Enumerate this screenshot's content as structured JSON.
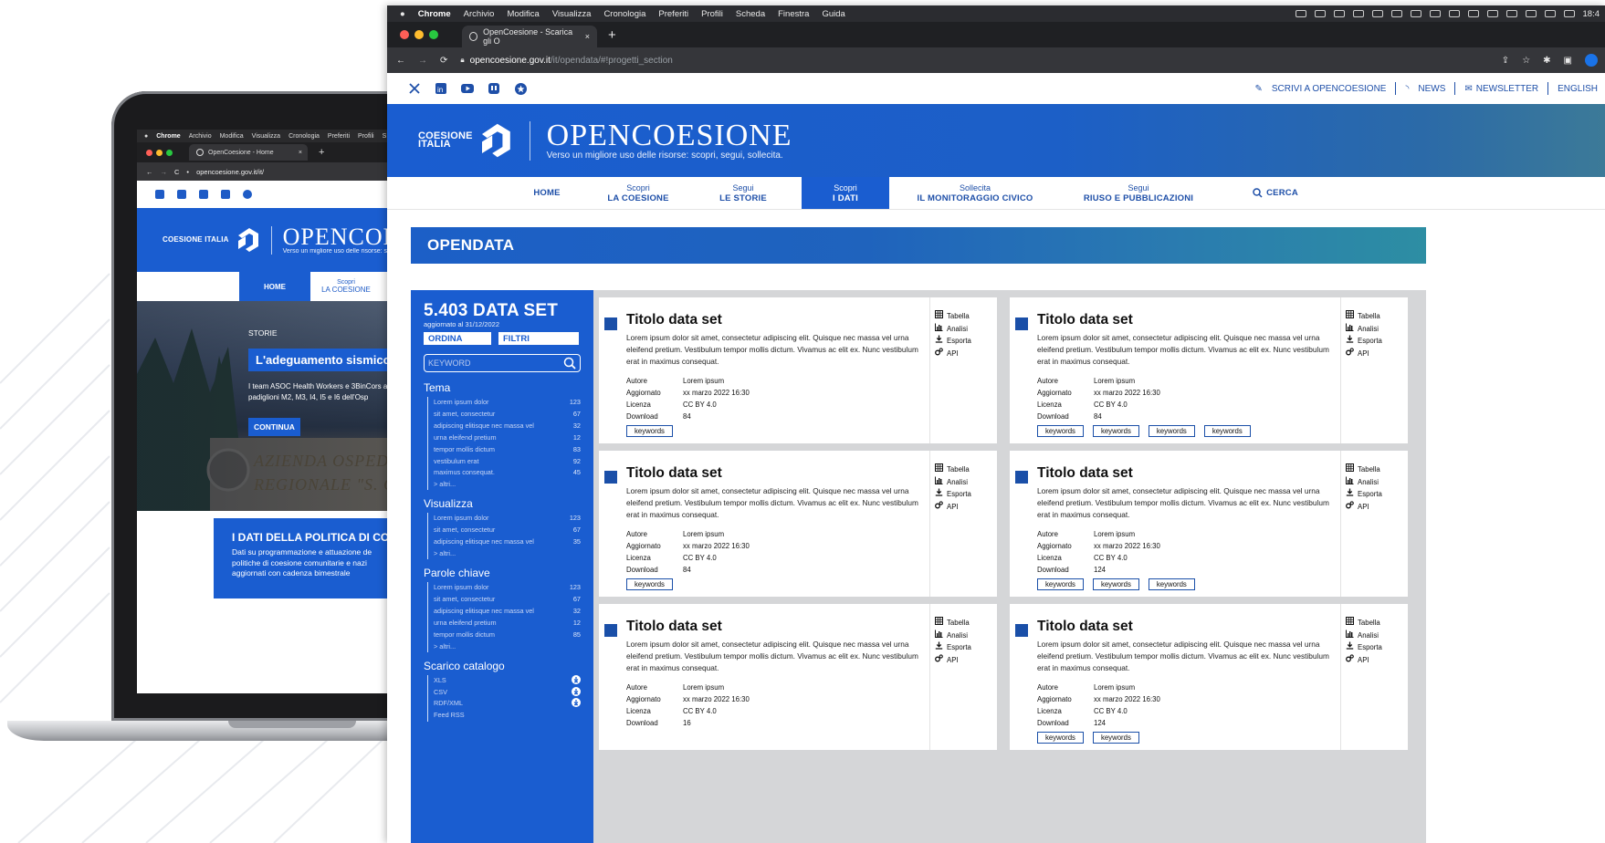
{
  "colors": {
    "brand_blue": "#1a5dd0",
    "dark_blue": "#1a4fa8",
    "nav_blue": "#1e4fa8"
  },
  "laptop": {
    "menubar": [
      "Chrome",
      "Archivio",
      "Modifica",
      "Visualizza",
      "Cronologia",
      "Preferiti",
      "Profili",
      "S"
    ],
    "tab_title": "OpenCoesione - Home",
    "url": "opencoesione.gov.it/it/",
    "logo": "COESIONE ITALIA",
    "brand": "OPENCOESI",
    "tagline": "Verso un migliore uso delle risorse: scop",
    "nav": [
      {
        "l1": "",
        "l2": "HOME"
      },
      {
        "l1": "Scopri",
        "l2": "LA COESIONE"
      }
    ],
    "story_label": "STORIE",
    "story_title": "L'adeguamento sismico de",
    "story_text": "I team ASOC Health Workers e 3BinCors ai padiglioni M2, M3, I4, I5 e I6 dell'Osp",
    "continue": "CONTINUA",
    "sign_line1": "AZIENDA OSPEDA",
    "sign_line2": "REGIONALE \"S. C",
    "card_title": "I DATI DELLA POLITICA DI COE",
    "card_text": "Dati su programmazione e attuazione de politiche di coesione comunitarie e nazi aggiornati con cadenza bimestrale"
  },
  "browser": {
    "menubar": [
      "Chrome",
      "Archivio",
      "Modifica",
      "Visualizza",
      "Cronologia",
      "Preferiti",
      "Profili",
      "Scheda",
      "Finestra",
      "Guida"
    ],
    "clock": "18:4",
    "tab_title": "OpenCoesione - Scarica gli O",
    "url_host": "opencoesione.gov.it",
    "url_path": "/it/opendata/#!progetti_section",
    "toplinks": [
      "SCRIVI A OPENCOESIONE",
      "NEWS",
      "NEWSLETTER",
      "ENGLISH"
    ],
    "logo_line1": "COESIONE",
    "logo_line2": "ITALIA",
    "brand": "OPENCOESIONE",
    "tagline": "Verso un migliore uso delle risorse: scopri, segui, sollecita.",
    "nav": [
      {
        "l1": "",
        "l2": "HOME"
      },
      {
        "l1": "Scopri",
        "l2": "LA COESIONE"
      },
      {
        "l1": "Segui",
        "l2": "LE STORIE"
      },
      {
        "l1": "Scopri",
        "l2": "I DATI"
      },
      {
        "l1": "Sollecita",
        "l2": "IL MONITORAGGIO CIVICO"
      },
      {
        "l1": "Segui",
        "l2": "RIUSO E PUBBLICAZIONI"
      },
      {
        "l1": "",
        "l2": "CERCA"
      }
    ],
    "section_title": "OPENDATA"
  },
  "sidebar": {
    "title": "5.403 DATA SET",
    "updated": "aggiornato al 31/12/2022",
    "sort": "ORDINA",
    "filter": "FILTRI",
    "search_placeholder": "KEYWORD",
    "groups": [
      {
        "title": "Tema",
        "items": [
          {
            "label": "Lorem ipsum dolor",
            "count": "123"
          },
          {
            "label": "sit amet, consectetur",
            "count": "67"
          },
          {
            "label": "adipiscing elitisque nec massa vel",
            "count": "32"
          },
          {
            "label": "urna eleifend pretium",
            "count": "12"
          },
          {
            "label": "tempor mollis dictum",
            "count": "83"
          },
          {
            "label": "vestibulum erat",
            "count": "92"
          },
          {
            "label": "maximus consequat.",
            "count": "45"
          }
        ],
        "more": "> altri..."
      },
      {
        "title": "Visualizza",
        "items": [
          {
            "label": "Lorem ipsum dolor",
            "count": "123"
          },
          {
            "label": "sit amet, consectetur",
            "count": "67"
          },
          {
            "label": "adipiscing elitisque nec massa vel",
            "count": "35"
          }
        ],
        "more": "> altri..."
      },
      {
        "title": "Parole chiave",
        "items": [
          {
            "label": "Lorem ipsum dolor",
            "count": "123"
          },
          {
            "label": "sit amet, consectetur",
            "count": "67"
          },
          {
            "label": "adipiscing elitisque nec massa vel",
            "count": "32"
          },
          {
            "label": "urna eleifend pretium",
            "count": "12"
          },
          {
            "label": "tempor mollis dictum",
            "count": "85"
          }
        ],
        "more": "> altri..."
      }
    ],
    "catalog_title": "Scarico catalogo",
    "catalog": [
      "XLS",
      "CSV",
      "RDF/XML",
      "Feed RSS"
    ]
  },
  "card_common": {
    "title": "Titolo data set",
    "desc": "Lorem ipsum dolor sit amet, consectetur adipiscing elit. Quisque nec massa vel urna eleifend pretium. Vestibulum tempor mollis dictum. Vivamus ac elit ex. Nunc vestibulum erat in maximus consequat.",
    "labels": {
      "author": "Autore",
      "updated": "Aggiornato",
      "license": "Licenza",
      "download": "Download"
    },
    "actions": [
      "Tabella",
      "Analisi",
      "Esporta",
      "API"
    ]
  },
  "cards": [
    {
      "author": "Lorem ipsum",
      "updated": "xx marzo 2022 16:30",
      "license": "CC BY 4.0",
      "download": "84",
      "keywords": [
        "keywords"
      ]
    },
    {
      "author": "Lorem ipsum",
      "updated": "xx marzo 2022 16:30",
      "license": "CC BY 4.0",
      "download": "84",
      "keywords": [
        "keywords",
        "keywords",
        "keywords",
        "keywords"
      ]
    },
    {
      "author": "Lorem ipsum",
      "updated": "xx marzo 2022 16:30",
      "license": "CC BY 4.0",
      "download": "84",
      "keywords": [
        "keywords"
      ]
    },
    {
      "author": "Lorem ipsum",
      "updated": "xx marzo 2022 16:30",
      "license": "CC BY 4.0",
      "download": "124",
      "keywords": [
        "keywords",
        "keywords",
        "keywords"
      ]
    },
    {
      "author": "Lorem ipsum",
      "updated": "xx marzo 2022 16:30",
      "license": "CC BY 4.0",
      "download": "16",
      "keywords": []
    },
    {
      "author": "Lorem ipsum",
      "updated": "xx marzo 2022 16:30",
      "license": "CC BY 4.0",
      "download": "124",
      "keywords": [
        "keywords",
        "keywords"
      ]
    }
  ]
}
